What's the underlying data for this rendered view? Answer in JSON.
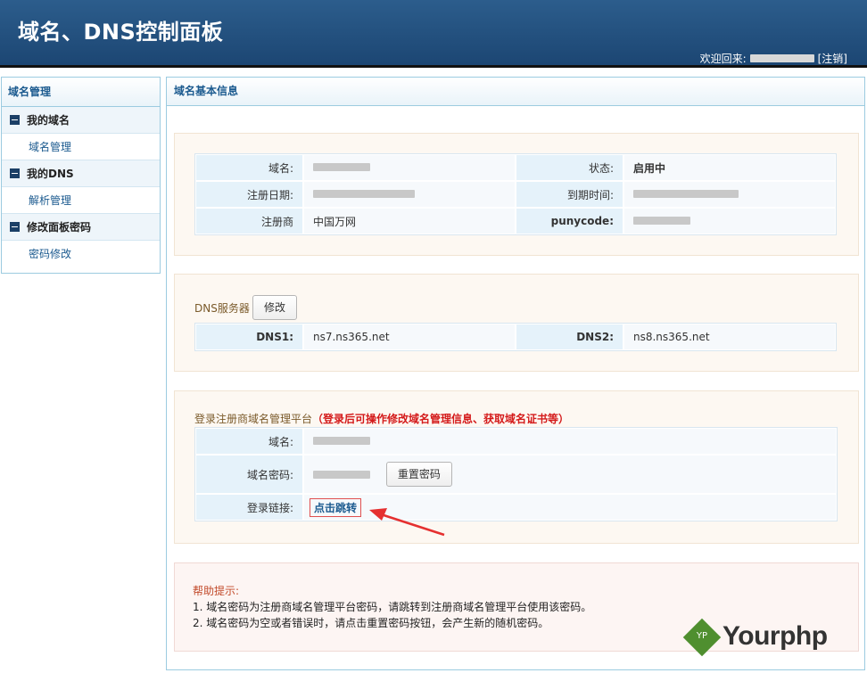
{
  "header": {
    "title": "域名、DNS控制面板",
    "welcome_label": "欢迎回来:",
    "logout_label": "[注销]"
  },
  "sidebar": {
    "title": "域名管理",
    "groups": [
      {
        "label": "我的域名",
        "items": [
          {
            "label": "域名管理"
          }
        ]
      },
      {
        "label": "我的DNS",
        "items": [
          {
            "label": "解析管理"
          }
        ]
      },
      {
        "label": "修改面板密码",
        "items": [
          {
            "label": "密码修改"
          }
        ]
      }
    ]
  },
  "main": {
    "title": "域名基本信息",
    "basic": {
      "domain_label": "域名:",
      "status_label": "状态:",
      "status_value": "启用中",
      "reg_date_label": "注册日期:",
      "expire_label": "到期时间:",
      "registrar_label": "注册商",
      "registrar_value": "中国万网",
      "punycode_label": "punycode:"
    },
    "dns": {
      "title": "DNS服务器",
      "edit_button": "修改",
      "dns1_label": "DNS1:",
      "dns1_value": "ns7.ns365.net",
      "dns2_label": "DNS2:",
      "dns2_value": "ns8.ns365.net"
    },
    "registrar_login": {
      "title": "登录注册商域名管理平台",
      "note": "（登录后可操作修改域名管理信息、获取域名证书等）",
      "domain_label": "域名:",
      "password_label": "域名密码:",
      "reset_button": "重置密码",
      "link_label": "登录链接:",
      "link_text": "点击跳转"
    },
    "help": {
      "title": "帮助提示:",
      "lines": [
        "1. 域名密码为注册商域名管理平台密码，请跳转到注册商域名管理平台使用该密码。",
        "2. 域名密码为空或者错误时，请点击重置密码按钮，会产生新的随机密码。"
      ]
    }
  },
  "watermark": {
    "icon_text": "YP",
    "brand": "Yourphp"
  },
  "colors": {
    "header_bg": "#1c4673",
    "border": "#9ccbe0",
    "label_bg": "#e5f2fa",
    "status_green": "#1a8a1a",
    "note_red": "#d41a1a",
    "arrow_red": "#e53030",
    "logo_green": "#4f8f2f"
  }
}
